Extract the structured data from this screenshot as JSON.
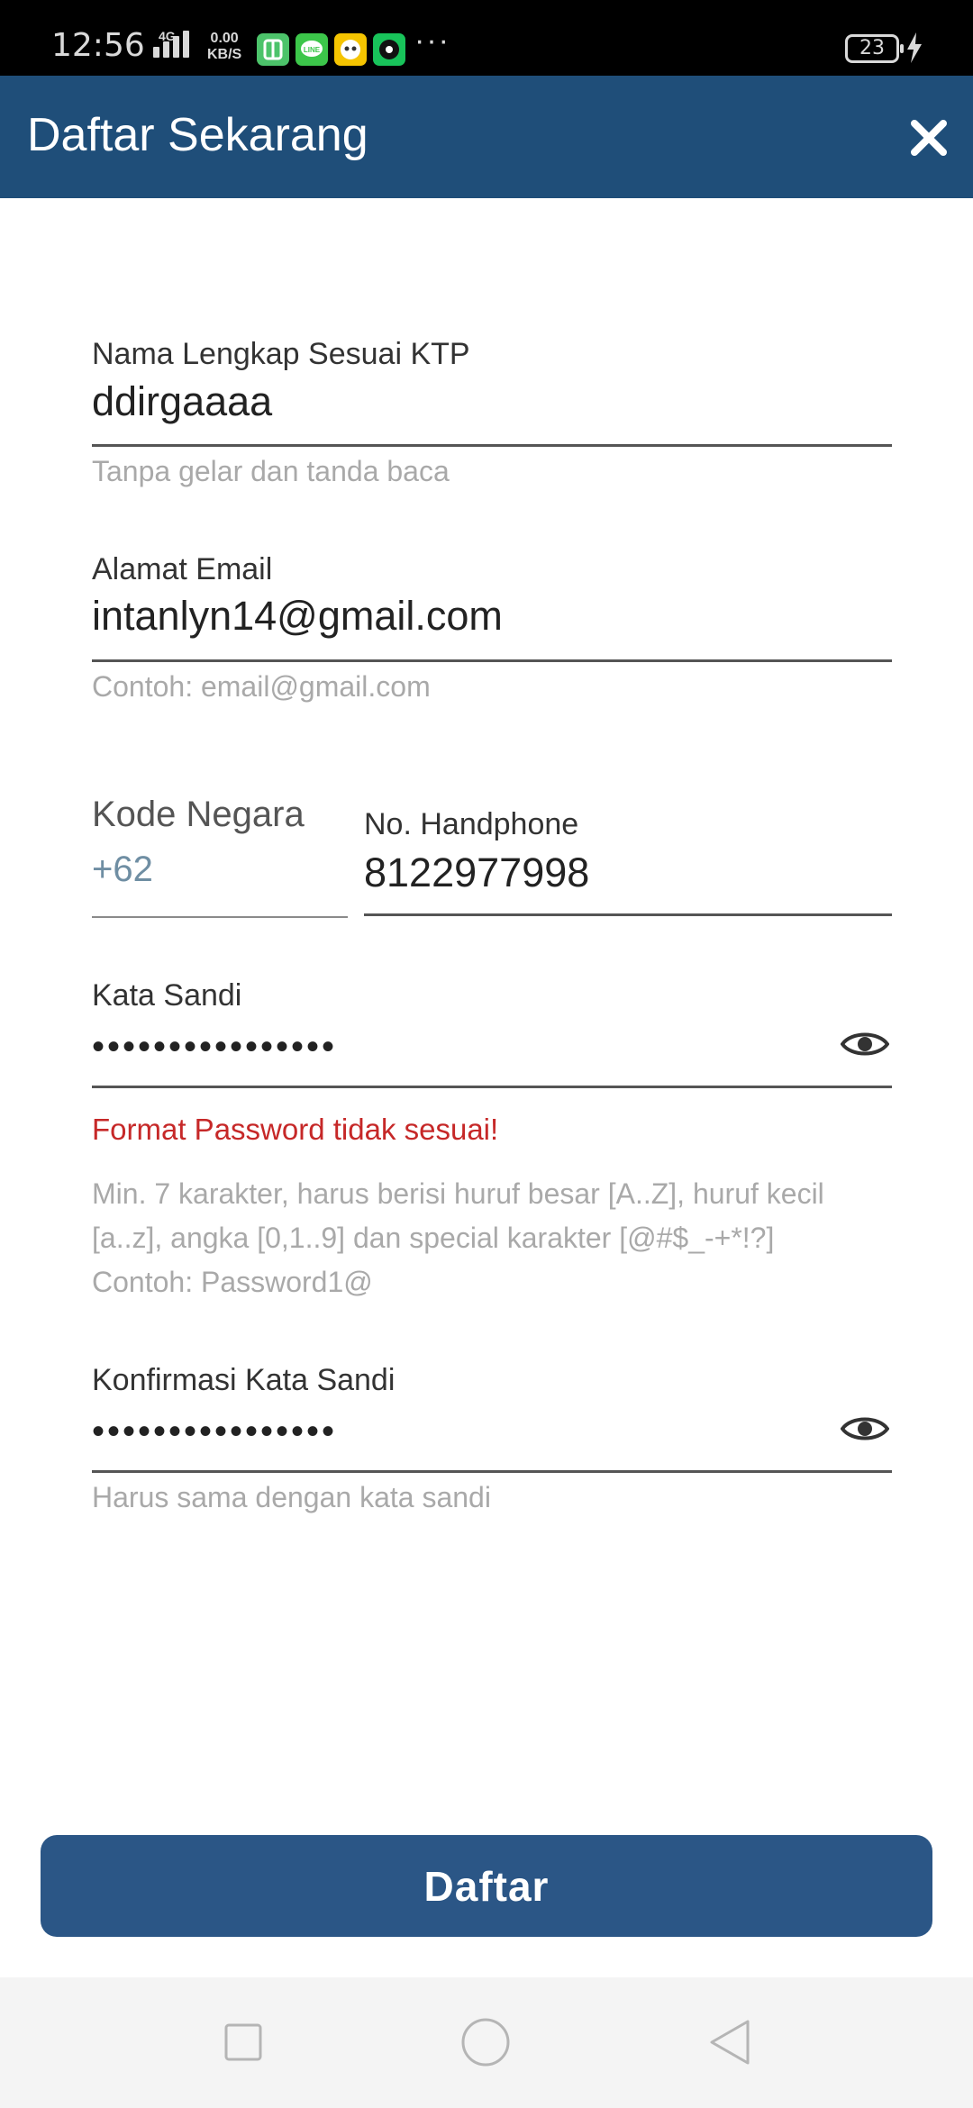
{
  "status_bar": {
    "time": "12:56",
    "network": "4G",
    "speed_value": "0.00",
    "speed_unit": "KB/S",
    "more": "···",
    "battery": "23"
  },
  "header": {
    "title": "Daftar Sekarang"
  },
  "form": {
    "full_name": {
      "label": "Nama Lengkap Sesuai KTP",
      "value": "ddirgaaaa",
      "helper": "Tanpa gelar dan tanda baca"
    },
    "email": {
      "label": "Alamat Email",
      "value": "intanlyn14@gmail.com",
      "helper": "Contoh: email@gmail.com"
    },
    "country_code": {
      "label": "Kode Negara",
      "value": "+62"
    },
    "phone": {
      "label": "No. Handphone",
      "value": "8122977998"
    },
    "password": {
      "label": "Kata Sandi",
      "value": "••••••••••••••••",
      "error": "Format Password tidak sesuai!",
      "hint_line1": "Min. 7 karakter, harus berisi huruf besar [A..Z], huruf kecil",
      "hint_line2": "[a..z], angka [0,1..9] dan special karakter [@#$_-+*!?]",
      "hint_line3": "Contoh: Password1@"
    },
    "confirm_password": {
      "label": "Konfirmasi Kata Sandi",
      "value": "••••••••••••••••",
      "helper": "Harus sama dengan kata sandi"
    }
  },
  "submit": {
    "label": "Daftar"
  },
  "colors": {
    "header_bg": "#1f4e79",
    "button_bg": "#2b5686",
    "error": "#c62828"
  },
  "icons": {
    "close": "close-icon",
    "eye": "eye-icon",
    "nav_recent": "square-icon",
    "nav_home": "circle-icon",
    "nav_back": "triangle-back-icon"
  }
}
